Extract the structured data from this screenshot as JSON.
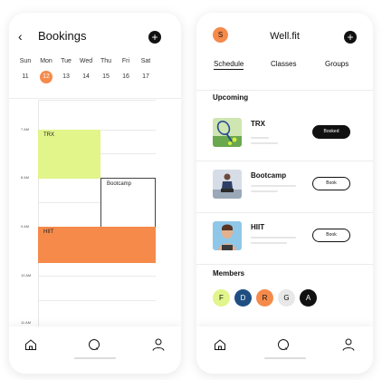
{
  "colors": {
    "accent": "#f58a4b",
    "lime": "#e1f58a",
    "dark": "#111111",
    "blue": "#1f4f82"
  },
  "bookings": {
    "title": "Bookings",
    "days": [
      {
        "name": "Sun",
        "num": "11"
      },
      {
        "name": "Mon",
        "num": "12"
      },
      {
        "name": "Tue",
        "num": "13"
      },
      {
        "name": "Wed",
        "num": "14"
      },
      {
        "name": "Thu",
        "num": "15"
      },
      {
        "name": "Fri",
        "num": "16"
      },
      {
        "name": "Sat",
        "num": "17"
      }
    ],
    "selected_day": "Mon",
    "times": [
      "7 AM",
      "8 AM",
      "9 AM",
      "10 AM",
      "11 AM"
    ],
    "events": [
      {
        "name": "TRX"
      },
      {
        "name": "Bootcamp"
      },
      {
        "name": "HIIT"
      }
    ]
  },
  "wellfit": {
    "avatar_letter": "S",
    "title": "Well.fit",
    "tabs": [
      "Schedule",
      "Classes",
      "Groups"
    ],
    "active_tab": "Schedule",
    "upcoming_heading": "Upcoming",
    "classes": [
      {
        "name": "TRX",
        "action": "Booked",
        "booked": true
      },
      {
        "name": "Bootcamp",
        "action": "Book",
        "booked": false
      },
      {
        "name": "HIIT",
        "action": "Book",
        "booked": false
      }
    ],
    "members_heading": "Members",
    "members": [
      {
        "initial": "F",
        "color": "#e1f58a"
      },
      {
        "initial": "D",
        "color": "#1f4f82"
      },
      {
        "initial": "R",
        "color": "#f58a4b"
      },
      {
        "initial": "G",
        "color": "#e8e8e8"
      },
      {
        "initial": "A",
        "color": "#111111"
      }
    ]
  },
  "icons": {
    "back": "chevron-left-icon",
    "add": "plus-icon",
    "home": "home-icon",
    "search": "search-icon",
    "profile": "user-icon"
  }
}
